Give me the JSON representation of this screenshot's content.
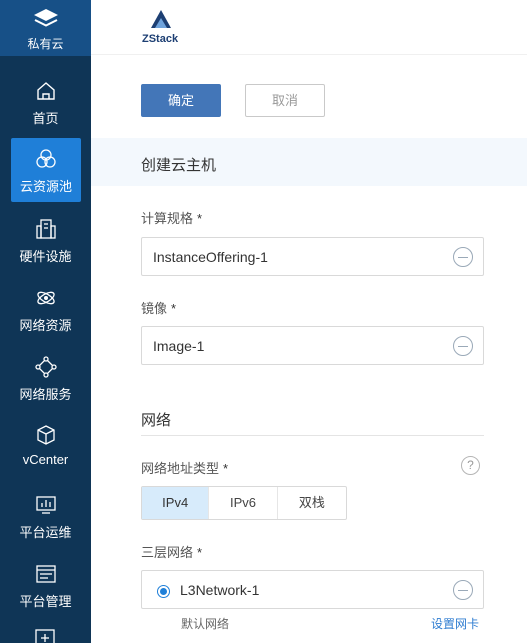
{
  "sidebar": {
    "brand": {
      "label": "私有云",
      "icon": "layers-icon"
    },
    "items": [
      {
        "label": "首页",
        "icon": "home-icon"
      },
      {
        "label": "云资源池",
        "icon": "cloud-pool-icon",
        "active": true
      },
      {
        "label": "硬件设施",
        "icon": "building-icon"
      },
      {
        "label": "网络资源",
        "icon": "network-orbit-icon"
      },
      {
        "label": "网络服务",
        "icon": "network-nodes-icon"
      },
      {
        "label": "vCenter",
        "icon": "cube-icon"
      },
      {
        "label": "平台运维",
        "icon": "monitor-chart-icon"
      },
      {
        "label": "平台管理",
        "icon": "window-list-icon"
      }
    ]
  },
  "header": {
    "logo_text": "ZStack"
  },
  "actions": {
    "confirm": "确定",
    "cancel": "取消"
  },
  "section_title": "创建云主机",
  "form": {
    "offering": {
      "label": "计算规格",
      "required": "*",
      "value": "InstanceOffering-1"
    },
    "image": {
      "label": "镜像",
      "required": "*",
      "value": "Image-1"
    },
    "network_heading": "网络",
    "addr_type": {
      "label": "网络地址类型",
      "required": "*",
      "options": [
        "IPv4",
        "IPv6",
        "双栈"
      ],
      "selected": "IPv4",
      "help": "?"
    },
    "l3": {
      "label": "三层网络",
      "required": "*",
      "value": "L3Network-1",
      "default_note": "默认网络",
      "nic_link": "设置网卡"
    }
  },
  "colors": {
    "sidebar_bg": "#0f3556",
    "brand_bg": "#175087",
    "active": "#1f7fd8",
    "primary": "#4376b8"
  }
}
